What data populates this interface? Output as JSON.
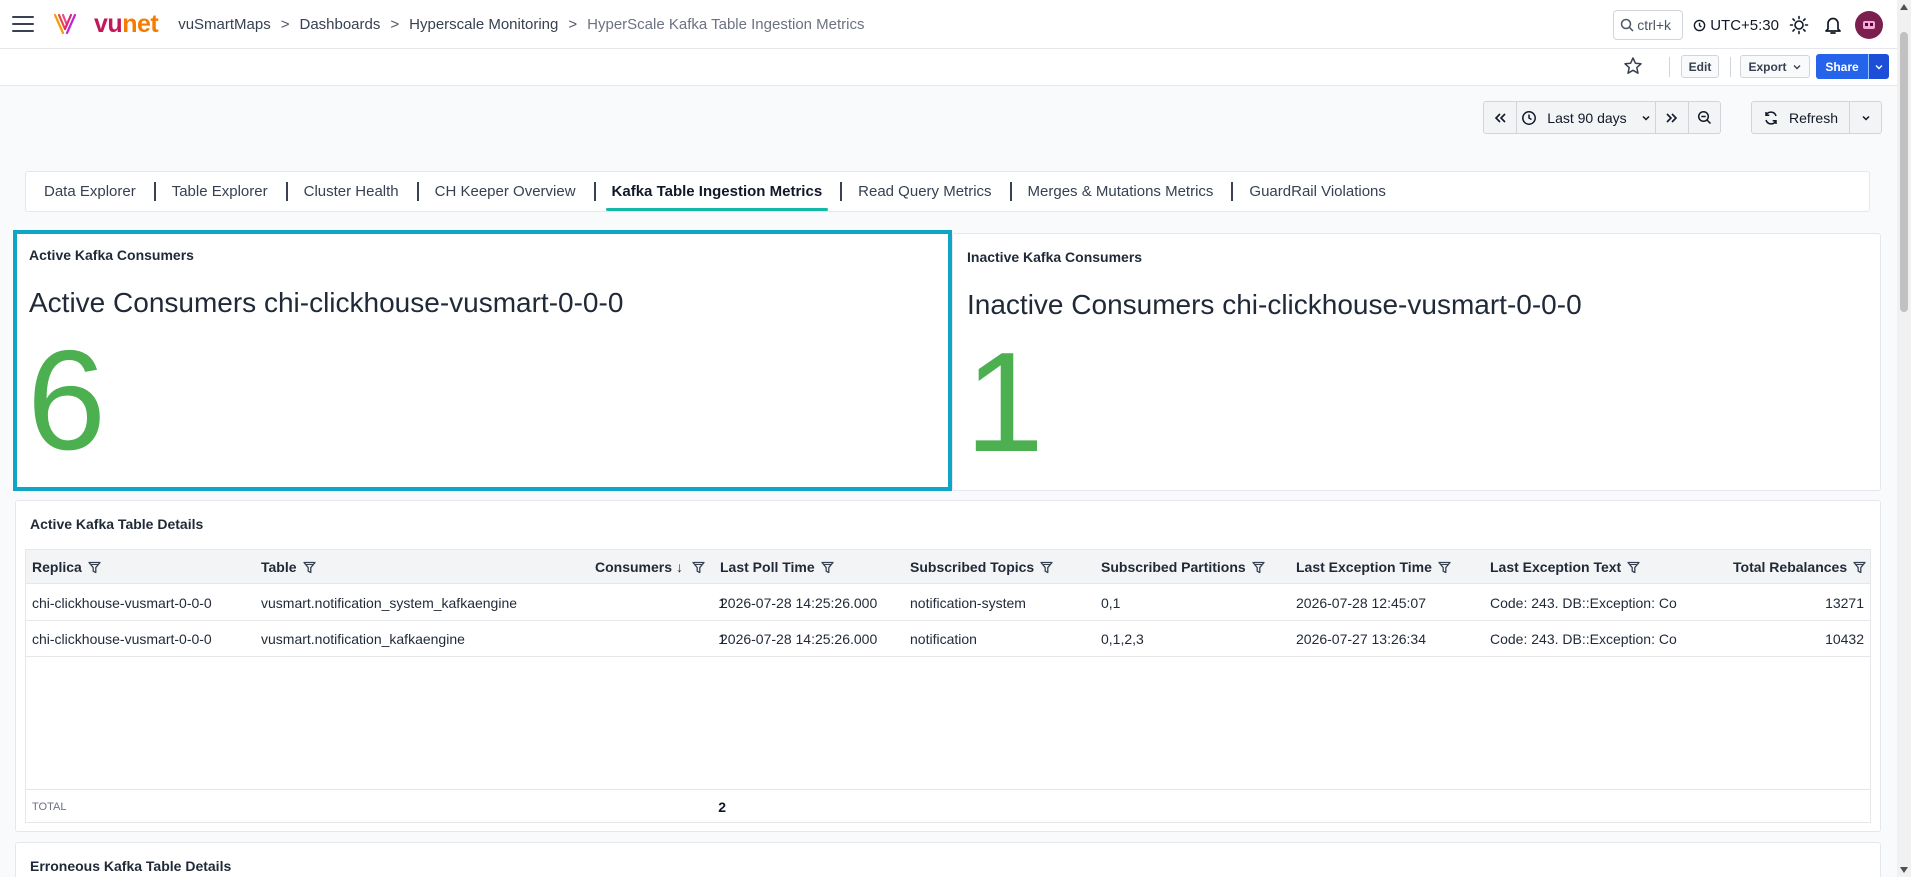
{
  "brand": {
    "vu": "vu",
    "net": "net"
  },
  "breadcrumb": {
    "items": [
      "vuSmartMaps",
      "Dashboards",
      "Hyperscale Monitoring"
    ],
    "current": "HyperScale Kafka Table Ingestion Metrics",
    "separator": ">"
  },
  "header": {
    "search_shortcut": "ctrl+k",
    "timezone": "UTC+5:30"
  },
  "actions": {
    "edit": "Edit",
    "export": "Export",
    "share": "Share"
  },
  "time": {
    "range": "Last 90 days",
    "refresh": "Refresh"
  },
  "tabs": [
    {
      "label": "Data Explorer"
    },
    {
      "label": "Table Explorer"
    },
    {
      "label": "Cluster Health"
    },
    {
      "label": "CH Keeper Overview"
    },
    {
      "label": "Kafka Table Ingestion Metrics",
      "active": true
    },
    {
      "label": "Read Query Metrics"
    },
    {
      "label": "Merges & Mutations Metrics"
    },
    {
      "label": "GuardRail Violations"
    }
  ],
  "active_panel": {
    "title": "Active Kafka Consumers",
    "heading": "Active Consumers chi-clickhouse-vusmart-0-0-0",
    "value": "6"
  },
  "inactive_panel": {
    "title": "Inactive Kafka Consumers",
    "heading": "Inactive Consumers chi-clickhouse-vusmart-0-0-0",
    "value": "1"
  },
  "details_table": {
    "title": "Active Kafka Table Details",
    "columns": [
      "Replica",
      "Table",
      "Consumers",
      "Last Poll Time",
      "Subscribed Topics",
      "Subscribed Partitions",
      "Last Exception Time",
      "Last Exception Text",
      "Total Rebalances"
    ],
    "sort_indicator": "↓",
    "rows": [
      [
        "chi-clickhouse-vusmart-0-0-0",
        "vusmart.notification_system_kafkaengine",
        "1",
        "2026-07-28 14:25:26.000",
        "notification-system",
        "0,1",
        "2026-07-28 12:45:07",
        "Code: 243. DB::Exception: Co",
        "13271"
      ],
      [
        "chi-clickhouse-vusmart-0-0-0",
        "vusmart.notification_kafkaengine",
        "1",
        "2026-07-28 14:25:26.000",
        "notification",
        "0,1,2,3",
        "2026-07-27 13:26:34",
        "Code: 243. DB::Exception: Co",
        "10432"
      ]
    ],
    "total_label": "TOTAL",
    "total_value": "2"
  },
  "erroneous_panel": {
    "title": "Erroneous Kafka Table Details"
  },
  "colors": {
    "accent": "#14b8a6",
    "kpi_green": "#4caf50",
    "selection": "#0ea5c6",
    "share_blue": "#2563eb"
  }
}
